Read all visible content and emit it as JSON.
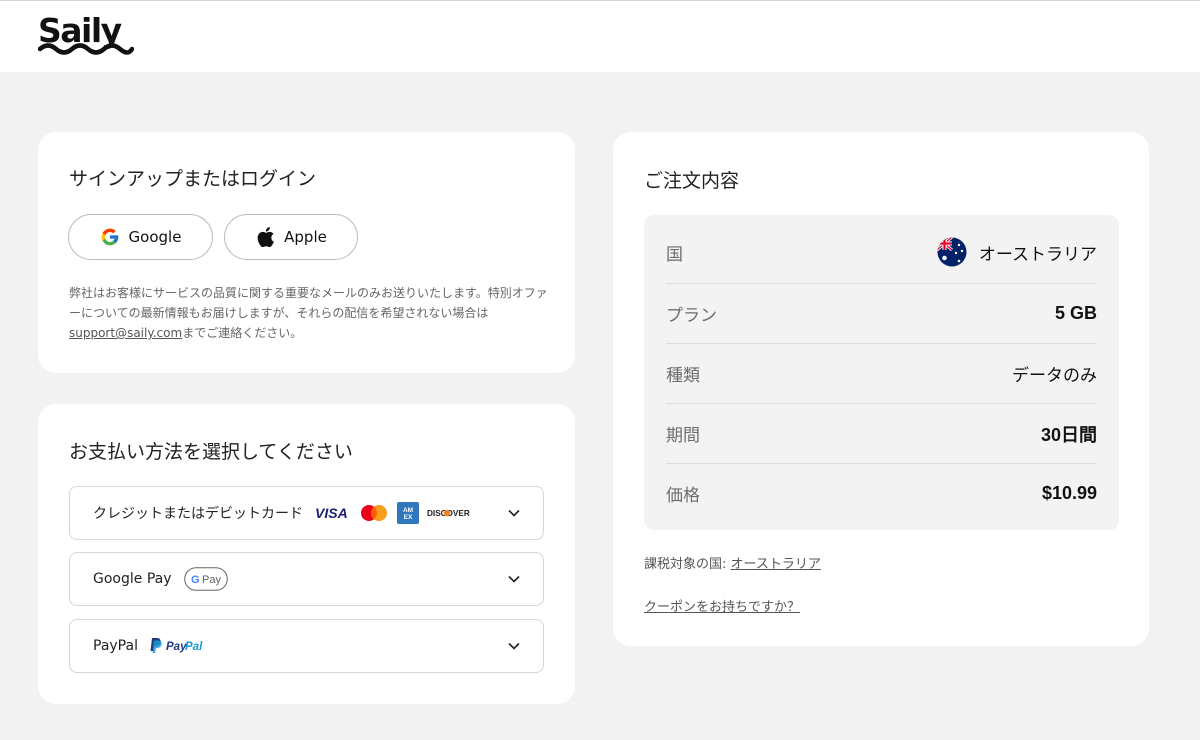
{
  "brand": {
    "name": "Saily"
  },
  "signin": {
    "title": "サインアップまたはログイン",
    "google_label": "Google",
    "apple_label": "Apple",
    "disclaimer_before": "弊社はお客様にサービスの品質に関する重要なメールのみお送りいたします。特別オファーについての最新情報もお届けしますが、それらの配信を希望されない場合は",
    "disclaimer_email": "support@saily.com",
    "disclaimer_after": "までご連絡ください。"
  },
  "payment": {
    "title": "お支払い方法を選択してください",
    "options": [
      {
        "label": "クレジットまたはデビットカード",
        "logos": [
          "VISA",
          "mastercard",
          "AMEX",
          "DISCOVER"
        ]
      },
      {
        "label": "Google Pay",
        "badge": "G Pay"
      },
      {
        "label": "PayPal",
        "badge": "PayPal"
      }
    ]
  },
  "order": {
    "title": "ご注文内容",
    "rows": [
      {
        "key": "国",
        "value": "オーストラリア",
        "icon": "australia-flag-icon"
      },
      {
        "key": "プラン",
        "value": "5 GB"
      },
      {
        "key": "種類",
        "value": "データのみ"
      },
      {
        "key": "期間",
        "value": "30日間"
      },
      {
        "key": "価格",
        "value": "$10.99"
      }
    ],
    "tax_label": "課税対象の国: ",
    "tax_country": "オーストラリア",
    "coupon_label": "クーポンをお持ちですか？"
  },
  "colors": {
    "page_bg": "#f2f2f2",
    "card_bg": "#ffffff",
    "visa_blue": "#1a1f71",
    "mastercard_red": "#eb001b",
    "mastercard_orange": "#f79e1b",
    "amex_blue": "#2e77bc",
    "paypal_blue": "#253b80",
    "paypal_light": "#179bd7"
  }
}
